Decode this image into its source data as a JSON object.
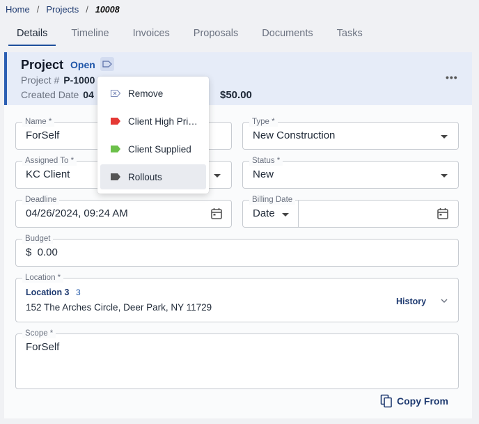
{
  "breadcrumb": {
    "home": "Home",
    "sep1": "/",
    "projects": "Projects",
    "sep2": "/",
    "current": "10008"
  },
  "tabs": [
    {
      "label": "Details",
      "active": true
    },
    {
      "label": "Timeline"
    },
    {
      "label": "Invoices"
    },
    {
      "label": "Proposals"
    },
    {
      "label": "Documents"
    },
    {
      "label": "Tasks"
    }
  ],
  "header": {
    "title": "Project",
    "status": "Open",
    "project_no_label": "Project #",
    "project_no_value": "P-1000",
    "created_label": "Created Date",
    "created_value": "04",
    "amount": "$50.00",
    "more": "•••"
  },
  "form": {
    "name": {
      "label": "Name *",
      "value": "ForSelf"
    },
    "type": {
      "label": "Type *",
      "value": "New Construction"
    },
    "assigned": {
      "label": "Assigned To *",
      "value": "KC Client"
    },
    "status": {
      "label": "Status *",
      "value": "New"
    },
    "deadline": {
      "label": "Deadline",
      "value": "04/26/2024, 09:24 AM"
    },
    "billing": {
      "label": "Billing Date",
      "value": "Date"
    },
    "budget": {
      "label": "Budget",
      "value": "$  0.00"
    },
    "location": {
      "label": "Location *",
      "name": "Location 3",
      "count": "3",
      "address": "152 The Arches Circle, Deer Park, NY 11729",
      "history": "History"
    },
    "scope": {
      "label": "Scope *",
      "value": "ForSelf"
    }
  },
  "copy_from": "Copy From",
  "tag_menu": {
    "items": [
      {
        "label": "Remove",
        "icon": "remove-tag-icon",
        "color": "#7b8ab8"
      },
      {
        "label": "Client High Priority",
        "icon": "tag-icon",
        "color": "#e53935"
      },
      {
        "label": "Client Supplied",
        "icon": "tag-icon",
        "color": "#6cc04a"
      },
      {
        "label": "Rollouts",
        "icon": "tag-icon",
        "color": "#555555"
      }
    ]
  },
  "colors": {
    "accent": "#2c5fb3",
    "link": "#1e3a70",
    "header_bg": "#e6ecf8"
  }
}
